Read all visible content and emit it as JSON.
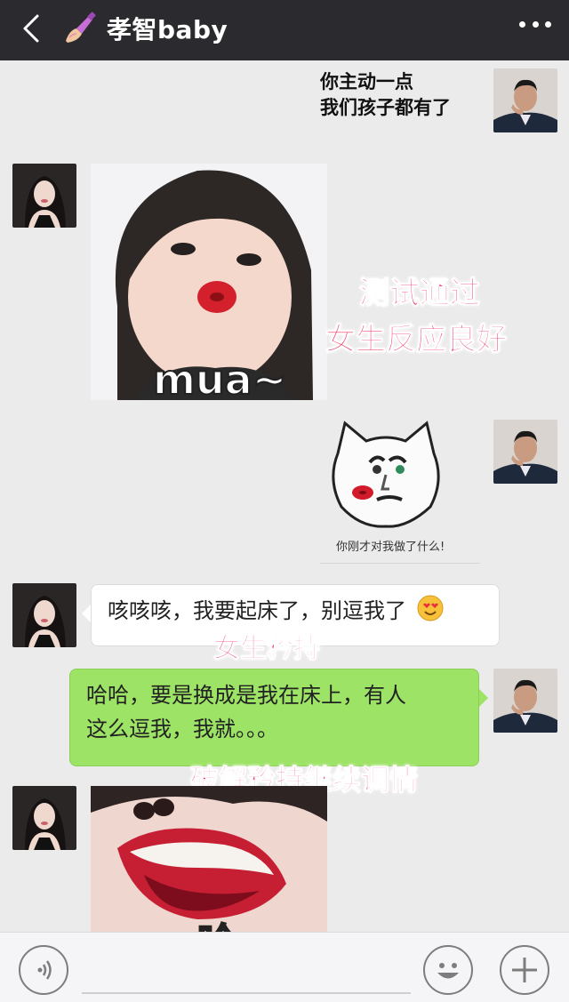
{
  "header": {
    "title": "孝智baby",
    "title_icon": "nail-polish-emoji"
  },
  "messages": [
    {
      "sender": "self",
      "text_line1": "你主动一点",
      "text_line2": "我们孩子都有了"
    },
    {
      "sender": "other",
      "type": "sticker",
      "sticker_text": "mua~"
    },
    {
      "sender": "self",
      "type": "sticker",
      "sticker_caption": "你刚才对我做了什么!"
    },
    {
      "sender": "other",
      "type": "text",
      "text": "咳咳咳，我要起床了，别逗我了"
    },
    {
      "sender": "self",
      "type": "text",
      "text_line1": "哈哈，要是换成是我在床上，有人",
      "text_line2": "这么逗我，我就。。。"
    },
    {
      "sender": "other",
      "type": "sticker",
      "sticker_text": "哈"
    }
  ],
  "annotations": {
    "a1_line1": "测试通过",
    "a1_line2": "女生反应良好",
    "a2": "女生矜持",
    "a3": "破解矜持继续调情"
  },
  "input_bar": {
    "voice_icon": "voice-icon",
    "emoji_icon": "emoji-icon",
    "plus_icon": "plus-icon"
  },
  "colors": {
    "header_bg": "#2b2b2f",
    "chat_bg": "#ebebeb",
    "green_bubble": "#9de365",
    "annotation": "#f02d5e"
  }
}
